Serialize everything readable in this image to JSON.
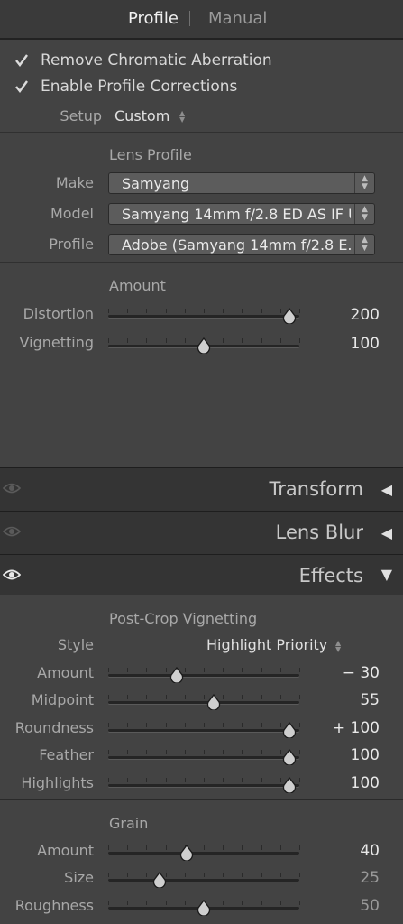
{
  "tabs": {
    "profile": "Profile",
    "manual": "Manual"
  },
  "lens_corrections": {
    "remove_ca": {
      "label": "Remove Chromatic Aberration",
      "checked": true
    },
    "enable_profile": {
      "label": "Enable Profile Corrections",
      "checked": true
    },
    "setup": {
      "label": "Setup",
      "value": "Custom"
    },
    "lens_profile_title": "Lens Profile",
    "make": {
      "label": "Make",
      "value": "Samyang"
    },
    "model": {
      "label": "Model",
      "value": "Samyang 14mm f/2.8 ED AS IF U..."
    },
    "profile": {
      "label": "Profile",
      "value": "Adobe (Samyang 14mm f/2.8 E..."
    },
    "amount_title": "Amount",
    "distortion": {
      "label": "Distortion",
      "value": "200",
      "fraction": 0.95
    },
    "vignetting": {
      "label": "Vignetting",
      "value": "100",
      "fraction": 0.5
    }
  },
  "sections": {
    "transform": "Transform",
    "lens_blur": "Lens Blur",
    "effects": "Effects"
  },
  "effects": {
    "post_crop_title": "Post-Crop Vignetting",
    "style": {
      "label": "Style",
      "value": "Highlight Priority"
    },
    "amount": {
      "label": "Amount",
      "value": "− 30",
      "fraction": 0.36
    },
    "midpoint": {
      "label": "Midpoint",
      "value": "55",
      "fraction": 0.55
    },
    "roundness": {
      "label": "Roundness",
      "value": "+ 100",
      "fraction": 0.95
    },
    "feather": {
      "label": "Feather",
      "value": "100",
      "fraction": 0.95
    },
    "highlights": {
      "label": "Highlights",
      "value": "100",
      "fraction": 0.95
    },
    "grain_title": "Grain",
    "grain_amount": {
      "label": "Amount",
      "value": "40",
      "fraction": 0.41
    },
    "grain_size": {
      "label": "Size",
      "value": "25",
      "fraction": 0.27
    },
    "grain_roughness": {
      "label": "Roughness",
      "value": "50",
      "fraction": 0.5
    }
  },
  "icons": {
    "checkbox": "checkmark-icon",
    "eye": "eye-icon",
    "stepper": "up-down-arrows-icon"
  },
  "colors": {
    "panel": "#434343",
    "section_bar": "#343434",
    "text": "#d8d8d8"
  }
}
